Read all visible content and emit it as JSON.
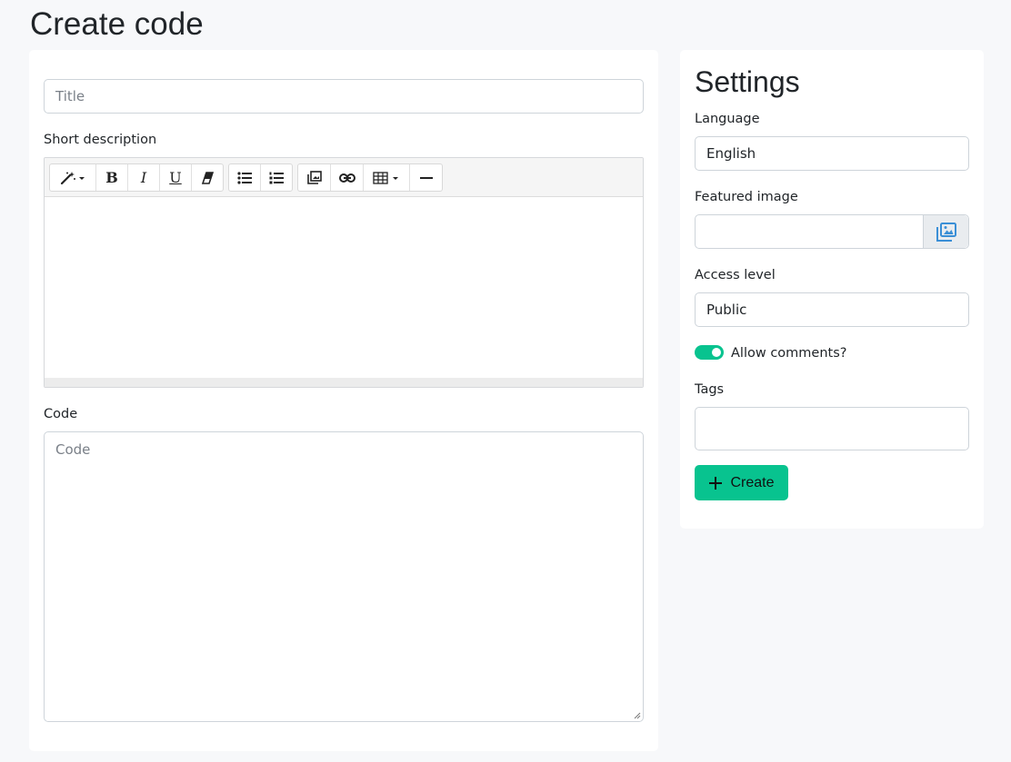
{
  "page": {
    "title": "Create code"
  },
  "main": {
    "title_field": {
      "placeholder": "Title",
      "value": ""
    },
    "short_description": {
      "label": "Short description"
    },
    "toolbar": {
      "groups": [
        [
          "magic-wand-icon",
          "bold-icon",
          "italic-icon",
          "underline-icon",
          "eraser-icon"
        ],
        [
          "unordered-list-icon",
          "ordered-list-icon"
        ],
        [
          "image-icon",
          "link-icon",
          "table-icon",
          "horizontal-rule-icon"
        ]
      ],
      "bold_glyph": "B",
      "italic_glyph": "I",
      "underline_glyph": "U"
    },
    "code": {
      "label": "Code",
      "placeholder": "Code",
      "value": ""
    }
  },
  "settings": {
    "title": "Settings",
    "language": {
      "label": "Language",
      "value": "English"
    },
    "featured_image": {
      "label": "Featured image",
      "value": "",
      "button_icon": "images-icon"
    },
    "access_level": {
      "label": "Access level",
      "value": "Public"
    },
    "allow_comments": {
      "label": "Allow comments?",
      "checked": true
    },
    "tags": {
      "label": "Tags",
      "value": ""
    },
    "create_button": {
      "label": "Create",
      "icon": "plus-icon"
    }
  },
  "colors": {
    "accent": "#08c38f",
    "background": "#f7f8fa",
    "icon_blue": "#3a8fd6"
  }
}
